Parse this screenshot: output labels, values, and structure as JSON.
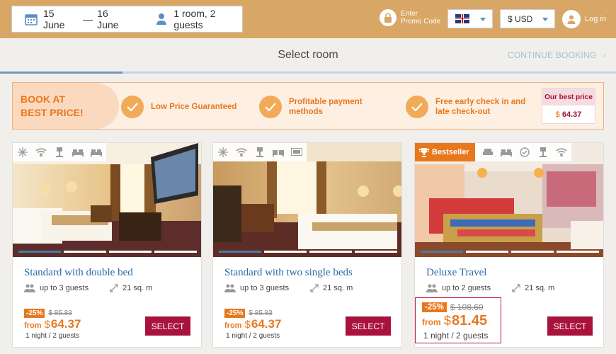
{
  "header": {
    "dates": {
      "checkin": "15 June",
      "separator": "—",
      "checkout": "16 June"
    },
    "guests": "1 room, 2 guests",
    "promo_label_line1": "Enter",
    "promo_label_line2": "Promo Code",
    "currency": "$ USD",
    "login": "Log in"
  },
  "steps": {
    "title": "Select room",
    "continue": "CONTINUE BOOKING"
  },
  "banner": {
    "title_line1": "BOOK AT",
    "title_line2": "BEST PRICE!",
    "features": [
      {
        "line1": "Low Price Guaranteed",
        "line2": ""
      },
      {
        "line1": "Profitable payment",
        "line2": "methods"
      },
      {
        "line1": "Free early check in and",
        "line2": "late check-out"
      }
    ],
    "best_label": "Our best price",
    "best_currency": "$",
    "best_price": "64.37"
  },
  "rooms": [
    {
      "name": "Standard with double bed",
      "guests": "up to 3 guests",
      "area": "21 sq. m",
      "discount": "-25%",
      "old_price": "$ 85.83",
      "from": "from",
      "currency": "$",
      "price": "64.37",
      "per": "1 night / 2 guests",
      "select": "SELECT"
    },
    {
      "name": "Standard with two single beds",
      "guests": "up to 3 guests",
      "area": "21 sq. m",
      "discount": "-25%",
      "old_price": "$ 85.83",
      "from": "from",
      "currency": "$",
      "price": "64.37",
      "per": "1 night / 2 guests",
      "select": "SELECT"
    },
    {
      "badge": "Bestseller",
      "name": "Deluxe Travel",
      "guests": "up to 2 guests",
      "area": "21 sq. m",
      "discount": "-25%",
      "old_price": "$ 108.60",
      "from": "from",
      "currency": "$",
      "price": "81.45",
      "per": "1 night / 2 guests",
      "select": "SELECT"
    }
  ],
  "colors": {
    "header_bg": "#d8a766",
    "accent_orange": "#e8781e",
    "button_red": "#a8123b",
    "link_blue": "#2b6aa6"
  }
}
